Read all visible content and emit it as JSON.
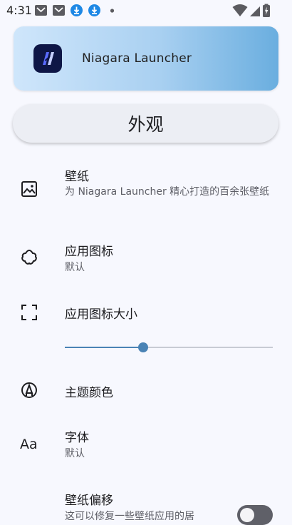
{
  "status_bar": {
    "time": "4:31"
  },
  "banner": {
    "app_name": "Niagara Launcher"
  },
  "section": {
    "title": "外观"
  },
  "settings": {
    "wallpaper": {
      "title": "壁纸",
      "subtitle": "为 Niagara Launcher 精心打造的百余张壁纸"
    },
    "app_icons": {
      "title": "应用图标",
      "subtitle": "默认"
    },
    "icon_size": {
      "title": "应用图标大小",
      "value_fraction": 0.377
    },
    "theme_color": {
      "title": "主题颜色"
    },
    "font": {
      "title": "字体",
      "subtitle": "默认",
      "icon_text": "Aa"
    },
    "wallpaper_offset": {
      "title": "壁纸偏移",
      "subtitle": "这可以修复一些壁纸应用的居",
      "enabled": false
    }
  },
  "colors": {
    "accent": "#4a83b5",
    "banner_start": "#cfe6fb",
    "banner_end": "#6aaedf"
  }
}
